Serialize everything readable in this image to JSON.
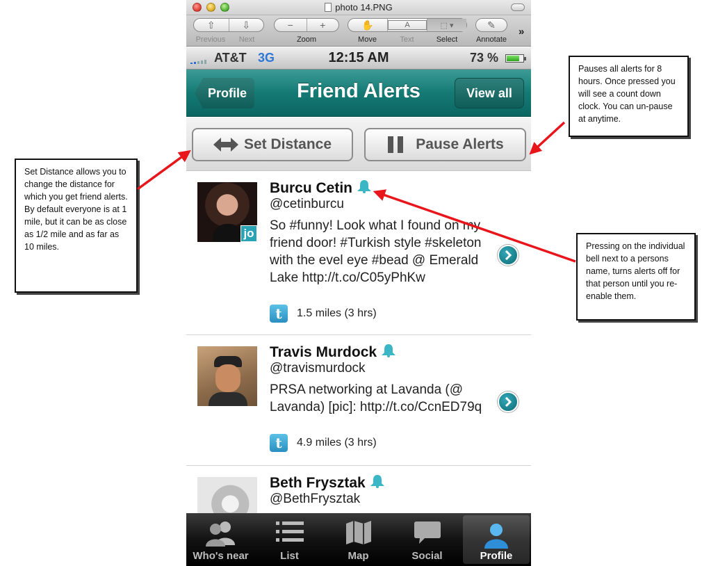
{
  "window": {
    "title": "photo 14.PNG"
  },
  "toolbar": {
    "previous": "Previous",
    "next": "Next",
    "zoom": "Zoom",
    "move": "Move",
    "text": "Text",
    "select": "Select",
    "annotate": "Annotate",
    "overflow": "»"
  },
  "status": {
    "carrier": "AT&T",
    "network": "3G",
    "time": "12:15 AM",
    "battery": "73 %",
    "battery_level": 0.73
  },
  "nav": {
    "back": "Profile",
    "title": "Friend Alerts",
    "right": "View all"
  },
  "actions": {
    "set_distance": "Set Distance",
    "pause_alerts": "Pause Alerts"
  },
  "feed": [
    {
      "name": "Burcu Cetin",
      "handle": "@cetinburcu",
      "text": "So #funny! Look what I found on my friend door! #Turkish style #skeleton with the evel eye #bead @ Emerald Lake http://t.co/C05yPhKw",
      "meta": "1.5 miles (3 hrs)",
      "badge": "jo"
    },
    {
      "name": "Travis Murdock",
      "handle": "@travismurdock",
      "text": "PRSA networking at Lavanda (@ Lavanda) [pic]: http://t.co/CcnED79q",
      "meta": "4.9 miles (3 hrs)"
    },
    {
      "name": "Beth Frysztak",
      "handle": "@BethFrysztak"
    }
  ],
  "tabs": [
    "Who's near",
    "List",
    "Map",
    "Social",
    "Profile"
  ],
  "callouts": {
    "set_distance": "Set Distance allows you to change the distance for which you get friend alerts. By default everyone is at 1 mile, but it can be as close as 1/2 mile and as far as 10 miles.",
    "pause": "Pauses all alerts for 8 hours. Once pressed you will see a count down clock. You can un-pause at anytime.",
    "bell": "Pressing on the individual bell next to a persons name, turns alerts off for that person until you re-enable them."
  },
  "colors": {
    "nav": "#157a74",
    "bell": "#3bb6c4",
    "annotation": "#e8151b",
    "network": "#2e77d6"
  }
}
